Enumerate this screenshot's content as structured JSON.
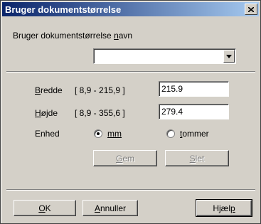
{
  "window": {
    "title": "Bruger dokumentstørrelse"
  },
  "name_section": {
    "label": "Bruger dokumentstørrelse navn",
    "value": ""
  },
  "width": {
    "label": "Bredde",
    "range": "[  8,9  -  215,9  ]",
    "value": "215.9"
  },
  "height": {
    "label": "Højde",
    "range": "[  8,9  -  355,6  ]",
    "value": "279.4"
  },
  "unit": {
    "label": "Enhed",
    "options": [
      {
        "label": "mm",
        "selected": true
      },
      {
        "label": "tommer",
        "selected": false
      }
    ]
  },
  "actions": {
    "save": "Gem",
    "delete": "Slet"
  },
  "footer": {
    "ok": "OK",
    "cancel": "Annuller",
    "help": "Hjælp"
  }
}
